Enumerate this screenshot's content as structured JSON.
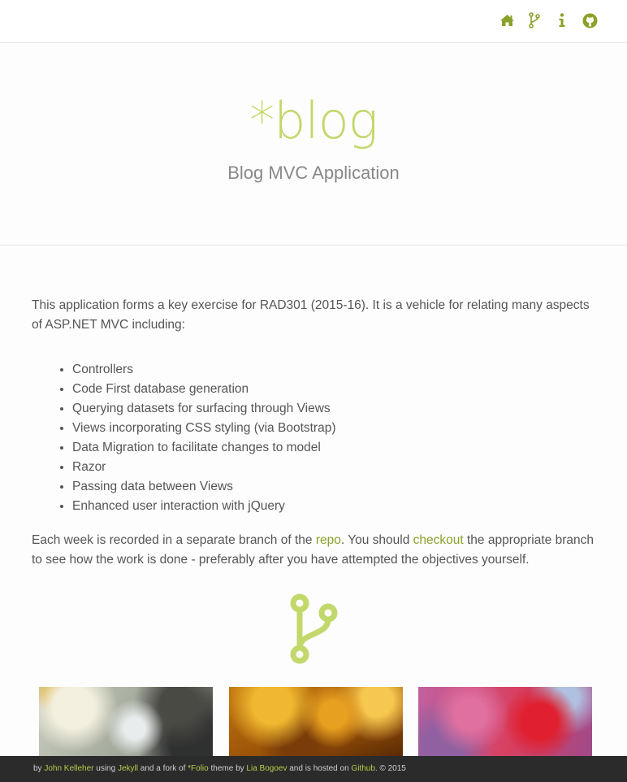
{
  "nav": {
    "icons": [
      "home-icon",
      "branch-icon",
      "info-icon",
      "github-icon"
    ]
  },
  "hero": {
    "title": "*blog",
    "subtitle": "Blog MVC Application"
  },
  "content": {
    "intro": "This application forms a key exercise for RAD301 (2015-16). It is a vehicle for relating many aspects of ASP.NET MVC including:",
    "features": [
      "Controllers",
      "Code First database generation",
      "Querying datasets for surfacing through Views",
      "Views incorporating CSS styling (via Bootstrap)",
      "Data Migration to facilitate changes to model",
      "Razor",
      "Passing data between Views",
      "Enhanced user interaction with jQuery"
    ],
    "para2_part1": "Each week is recorded in a separate branch of the ",
    "repo_link": "repo",
    "para2_part2": ". You should ",
    "checkout_link": "checkout",
    "para2_part3": " the appropriate branch to see how the work is done - preferably after you have attempted the objectives yourself."
  },
  "footer": {
    "t1": "by ",
    "author": "John Kelleher",
    "t2": " using ",
    "jekyll": "Jekyll",
    "t3": " and a fork of ",
    "theme": "*Folio",
    "t4": " theme by ",
    "lia": "Lia Bogoev",
    "t5": " and is hosted on ",
    "github": "Github",
    "t6": ". © 2015"
  },
  "colors": {
    "accent": "#c2d86a",
    "link": "#8aa12a",
    "footer_bg": "#2b2b2b",
    "nav_icon": "#8aa12a"
  }
}
